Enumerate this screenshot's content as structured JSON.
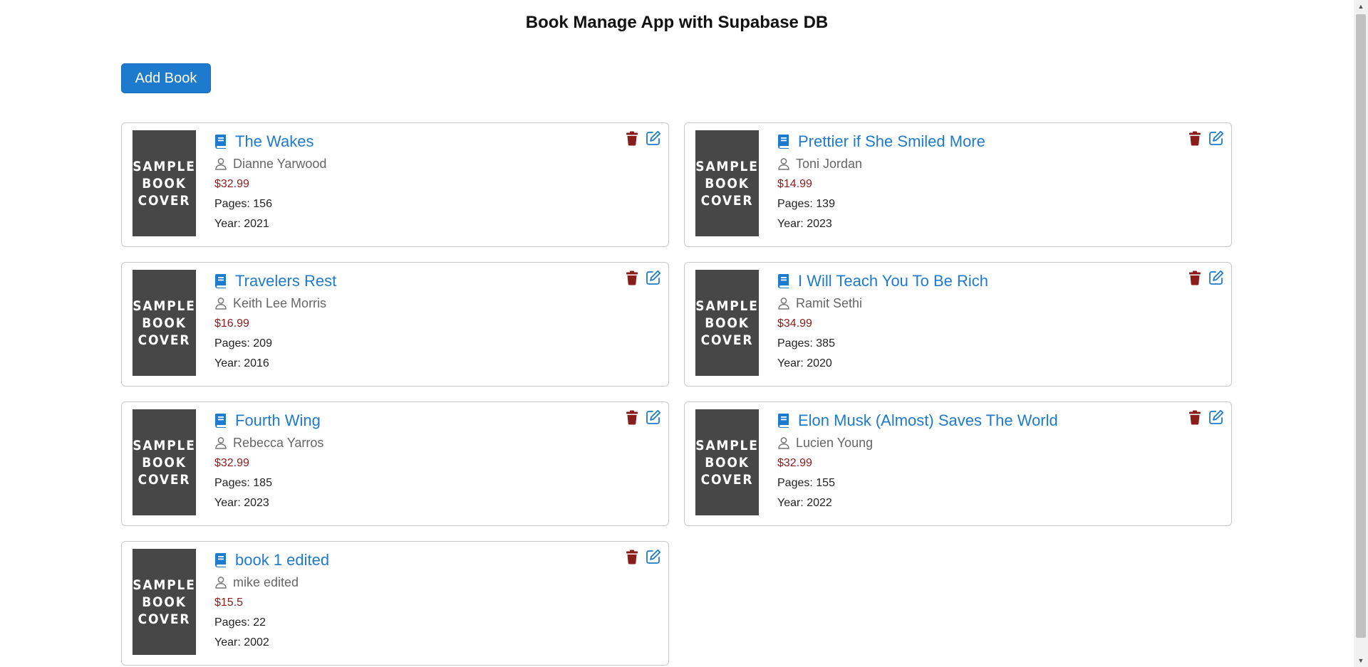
{
  "app": {
    "title": "Book Manage App with Supabase DB",
    "add_button": "Add Book"
  },
  "colors": {
    "accent": "#1e7acd",
    "price": "#8b1c1c",
    "delete": "#8b1c1c",
    "cover_bg": "#474747"
  },
  "cover_text": [
    "SAMPLE",
    "BOOK",
    "COVER"
  ],
  "labels": {
    "pages_prefix": "Pages: ",
    "year_prefix": "Year: "
  },
  "books": [
    {
      "title": "The Wakes",
      "author": "Dianne Yarwood",
      "price": "$32.99",
      "pages": "156",
      "year": "2021"
    },
    {
      "title": "Prettier if She Smiled More",
      "author": "Toni Jordan",
      "price": "$14.99",
      "pages": "139",
      "year": "2023"
    },
    {
      "title": "Travelers Rest",
      "author": "Keith Lee Morris",
      "price": "$16.99",
      "pages": "209",
      "year": "2016"
    },
    {
      "title": "I Will Teach You To Be Rich",
      "author": "Ramit Sethi",
      "price": "$34.99",
      "pages": "385",
      "year": "2020"
    },
    {
      "title": "Fourth Wing",
      "author": "Rebecca Yarros",
      "price": "$32.99",
      "pages": "185",
      "year": "2023"
    },
    {
      "title": "Elon Musk (Almost) Saves The World",
      "author": "Lucien Young",
      "price": "$32.99",
      "pages": "155",
      "year": "2022"
    },
    {
      "title": "book 1 edited",
      "author": "mike edited",
      "price": "$15.5",
      "pages": "22",
      "year": "2002"
    }
  ]
}
